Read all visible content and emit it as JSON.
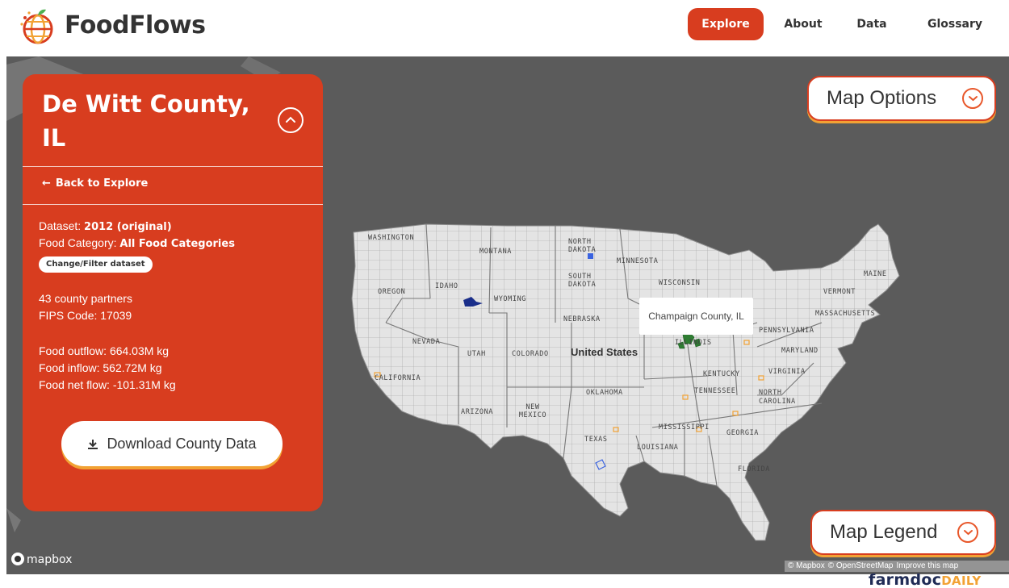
{
  "header": {
    "brand": "FoodFlows",
    "nav": [
      {
        "label": "Explore",
        "active": true
      },
      {
        "label": "About"
      },
      {
        "label": "Data"
      },
      {
        "label": "Glossary"
      }
    ]
  },
  "panel": {
    "title": "De Witt County, IL",
    "back_label": "Back to Explore",
    "dataset_label": "Dataset:",
    "dataset_value": "2012 (original)",
    "category_label": "Food Category:",
    "category_value": "All Food Categories",
    "filter_button": "Change/Filter dataset",
    "partners": "43 county partners",
    "fips": "FIPS Code: 17039",
    "outflow": "Food outflow: 664.03M kg",
    "inflow": "Food inflow: 562.72M kg",
    "net_flow": "Food net flow: -101.31M kg",
    "download_button": "Download County Data"
  },
  "map": {
    "options_label": "Map Options",
    "legend_label": "Map Legend",
    "tooltip": "Champaign County, IL",
    "country_label": "United States",
    "state_labels": [
      "WASHINGTON",
      "MONTANA",
      "NORTH DAKOTA",
      "MINNESOTA",
      "SOUTH DAKOTA",
      "WISCONSIN",
      "OREGON",
      "IDAHO",
      "WYOMING",
      "MAINE",
      "VERMONT",
      "MASSACHUSETTS",
      "NEBRASKA",
      "PENNSYLVANIA",
      "NEVADA",
      "UTAH",
      "COLORADO",
      "ILLINOIS",
      "MARYLAND",
      "CALIFORNIA",
      "KENTUCKY",
      "VIRGINIA",
      "OKLAHOMA",
      "TENNESSEE",
      "NORTH CAROLINA",
      "ARIZONA",
      "NEW MEXICO",
      "MISSISSIPPI",
      "GEORGIA",
      "TEXAS",
      "LOUISIANA",
      "FLORIDA"
    ],
    "attribution": [
      "© Mapbox",
      "© OpenStreetMap",
      "Improve this map"
    ],
    "mapbox_logo": "mapbox"
  },
  "watermark": {
    "main": "farmdoc",
    "suffix": "DAILY"
  },
  "colors": {
    "accent": "#d83d1f",
    "highlight": "#f2a234",
    "map_bg": "#5b5b5b",
    "land": "#e4e4e4"
  }
}
